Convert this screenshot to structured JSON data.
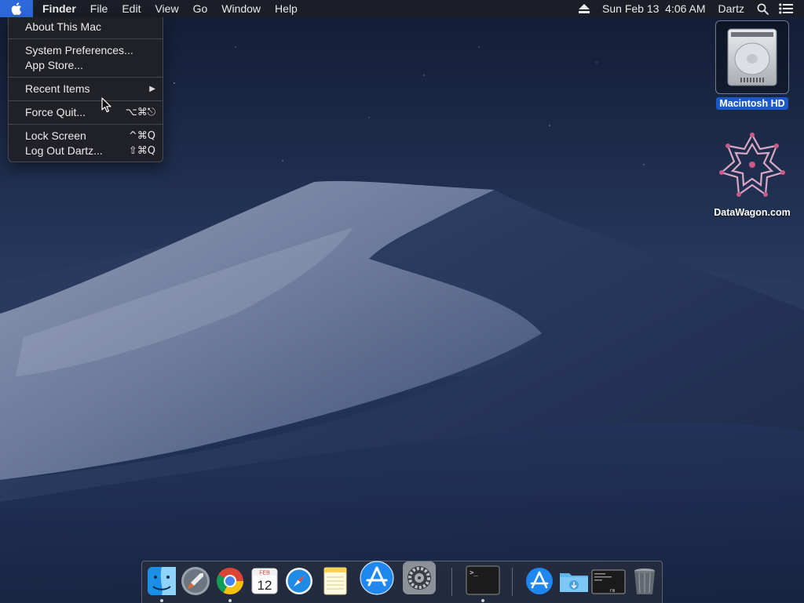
{
  "menubar": {
    "app_name": "Finder",
    "menus": [
      "File",
      "Edit",
      "View",
      "Go",
      "Window",
      "Help"
    ],
    "clock": "Sun Feb 13  4:06 AM",
    "user": "Dartz",
    "apple_highlight_color": "#2d69d9",
    "icons": [
      "apple-icon",
      "eject-icon",
      "spotlight-search-icon",
      "notification-center-icon"
    ]
  },
  "apple_menu": {
    "items": [
      {
        "label": "About This Mac",
        "shortcut": ""
      },
      {
        "label": "System Preferences...",
        "shortcut": ""
      },
      {
        "label": "App Store...",
        "shortcut": ""
      },
      {
        "label": "Recent Items",
        "shortcut": "",
        "submenu": true
      },
      {
        "label": "Force Quit...",
        "shortcut": "⌥⌘⎋"
      },
      {
        "label": "Lock Screen",
        "shortcut": "^⌘Q"
      },
      {
        "label": "Log Out Dartz...",
        "shortcut": "⇧⌘Q"
      }
    ]
  },
  "desktop": {
    "icons": [
      {
        "label": "Macintosh HD",
        "icon": "hard-drive-icon",
        "selected": true
      },
      {
        "label": "DataWagon.com",
        "icon": "datawagon-logo-icon",
        "selected": false
      }
    ],
    "selection_color": "#1b58c8"
  },
  "dock": {
    "items": [
      {
        "icon": "finder-icon",
        "running": true
      },
      {
        "icon": "launchpad-icon",
        "running": false
      },
      {
        "icon": "chrome-icon",
        "running": true
      },
      {
        "icon": "calendar-icon",
        "running": false,
        "month": "FEB",
        "day": "12"
      },
      {
        "icon": "safari-icon",
        "running": false
      },
      {
        "icon": "notes-icon",
        "running": false
      },
      {
        "icon": "app-store-icon",
        "running": false
      },
      {
        "icon": "system-preferences-icon",
        "running": false
      },
      {
        "icon": "terminal-icon",
        "running": true
      },
      {
        "icon": "app-store-downloads-icon",
        "running": false
      },
      {
        "icon": "downloads-folder-icon",
        "running": false
      },
      {
        "icon": "terminal-document-icon",
        "running": false,
        "caption": "rm"
      },
      {
        "icon": "trash-icon",
        "running": false
      }
    ]
  }
}
